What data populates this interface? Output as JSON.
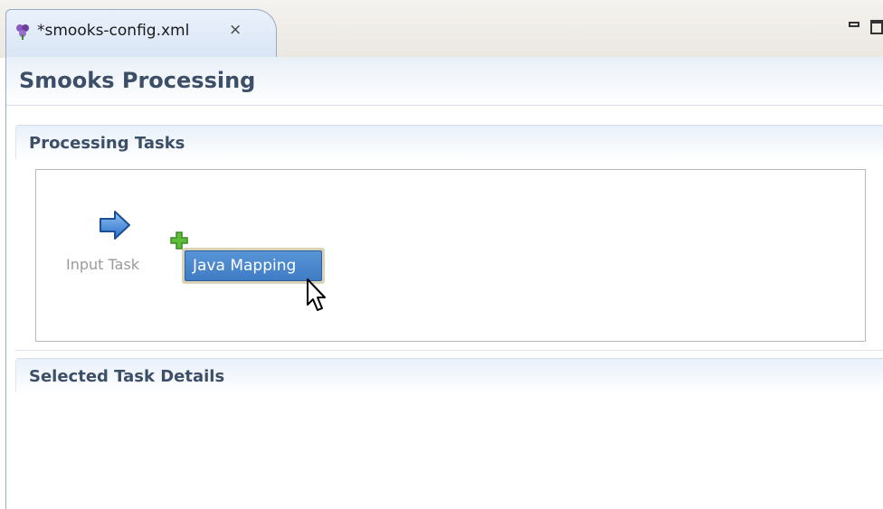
{
  "tab": {
    "title": "*smooks-config.xml",
    "close_symbol": "⨯"
  },
  "page": {
    "title": "Smooks Processing"
  },
  "sections": {
    "processing_tasks": {
      "title": "Processing Tasks"
    },
    "selected_task_details": {
      "title": "Selected Task Details"
    }
  },
  "canvas": {
    "input_task": {
      "label": "Input Task",
      "icon": "right-arrow-icon"
    },
    "add_icon": "plus-icon",
    "dragged_item": {
      "label": "Java Mapping"
    }
  },
  "colors": {
    "accent": "#3f7cc4",
    "header_text": "#3d4f68",
    "tab_bg": "#d9e5f5"
  }
}
